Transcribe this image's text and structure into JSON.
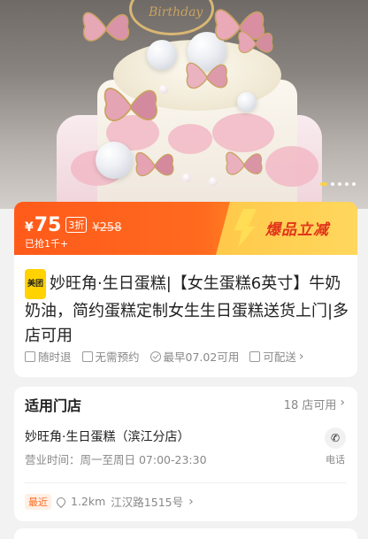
{
  "hero": {
    "ring_text": "Birthday",
    "overlay_text": "",
    "carousel_total": 5,
    "carousel_active": 1
  },
  "price_card": {
    "currency": "¥",
    "price": "75",
    "discount": "3折",
    "original_price": "¥258",
    "sold": "已抢1千+",
    "promo": "爆品立减"
  },
  "product": {
    "brand_tag": "美团",
    "title": "妙旺角·生日蛋糕|【女生蛋糕6英寸】牛奶奶油，简约蛋糕定制女生生日蛋糕送货上门|多店可用"
  },
  "features": [
    {
      "icon": "refund-icon",
      "label": "随时退"
    },
    {
      "icon": "calendar-check-icon",
      "label": "无需预约"
    },
    {
      "icon": "check-circle-icon",
      "label": "最早07.02可用"
    },
    {
      "icon": "delivery-icon",
      "label": "可配送"
    }
  ],
  "store": {
    "heading": "适用门店",
    "count": "18 店可用",
    "name": "妙旺角·生日蛋糕（滨江分店）",
    "hours": "营业时间：周一至周日 07:00-23:30",
    "phone_label": "电话",
    "nearest_tag": "最近",
    "distance": "1.2km",
    "address": "江汉路1515号"
  },
  "colors": {
    "accent_orange": "#ff5a1a",
    "promo_yellow": "#ffd75d",
    "promo_text": "#e0351a",
    "brand_yellow": "#ffd200"
  }
}
